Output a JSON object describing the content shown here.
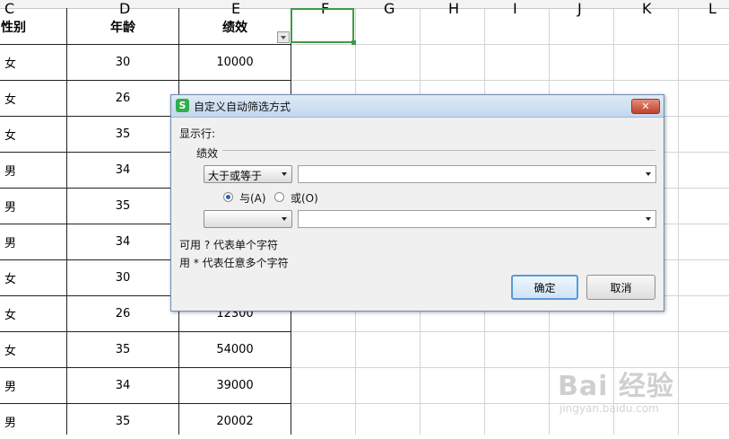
{
  "spreadsheet": {
    "column_letters": [
      "C",
      "D",
      "E",
      "F",
      "G",
      "H",
      "I",
      "J",
      "K",
      "L"
    ],
    "headers": [
      "性别",
      "年龄",
      "绩效"
    ],
    "rows": [
      {
        "gender": "女",
        "age": "30",
        "score": "10000"
      },
      {
        "gender": "女",
        "age": "26",
        "score": ""
      },
      {
        "gender": "女",
        "age": "35",
        "score": ""
      },
      {
        "gender": "男",
        "age": "34",
        "score": ""
      },
      {
        "gender": "男",
        "age": "35",
        "score": ""
      },
      {
        "gender": "男",
        "age": "34",
        "score": ""
      },
      {
        "gender": "女",
        "age": "30",
        "score": ""
      },
      {
        "gender": "女",
        "age": "26",
        "score": "12300"
      },
      {
        "gender": "女",
        "age": "35",
        "score": "54000"
      },
      {
        "gender": "男",
        "age": "34",
        "score": "39000"
      },
      {
        "gender": "男",
        "age": "35",
        "score": "20002"
      }
    ]
  },
  "dialog": {
    "title": "自定义自动筛选方式",
    "close_label": "✕",
    "show_rows_label": "显示行:",
    "field_label": "绩效",
    "condition1": {
      "operator": "大于或等于",
      "value": ""
    },
    "logic_and_label": "与(A)",
    "logic_or_label": "或(O)",
    "logic_selected": "and",
    "condition2": {
      "operator": "",
      "value": ""
    },
    "hint1": "可用 ? 代表单个字符",
    "hint2": "用 * 代表任意多个字符",
    "ok_label": "确定",
    "cancel_label": "取消"
  },
  "watermark": {
    "brand": "Bai 经验",
    "url": "jingyan.baidu.com"
  },
  "colors": {
    "selection": "#3e9a47",
    "app_icon": "#2fae4a"
  }
}
